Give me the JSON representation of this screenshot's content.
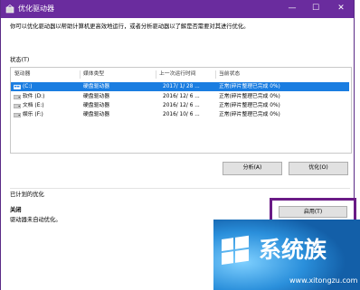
{
  "window": {
    "title": "优化驱动器",
    "minimize": "—",
    "maximize": "☐",
    "close": "✕"
  },
  "description": "你可以优化驱动器以帮助计算机更高效地运行，或者分析驱动器以了解是否需要对其进行优化。",
  "status_label": "状态(T)",
  "columns": [
    "驱动器",
    "媒体类型",
    "上一次运行时间",
    "当前状态"
  ],
  "drives": [
    {
      "name": "(C:)",
      "media": "硬盘驱动器",
      "last_run": "2017/  1/  28 ...",
      "status": "正常(碎片整理已完成 0%)",
      "selected": true
    },
    {
      "name": "软件 (D:)",
      "media": "硬盘驱动器",
      "last_run": "2016/  12/  6 ...",
      "status": "正常(碎片整理已完成 0%)",
      "selected": false
    },
    {
      "name": "文档 (E:)",
      "media": "硬盘驱动器",
      "last_run": "2016/  12/  6 ...",
      "status": "正常(碎片整理已完成 0%)",
      "selected": false
    },
    {
      "name": "娱乐 (F:)",
      "media": "硬盘驱动器",
      "last_run": "2016/  10/  6 ...",
      "status": "正常(碎片整理已完成 0%)",
      "selected": false
    }
  ],
  "buttons": {
    "analyze": "分析(A)",
    "optimize": "优化(O)",
    "enable": "启用(T)"
  },
  "scheduled": {
    "label": "已计划的优化",
    "state": "关闭",
    "detail": "驱动器未自动优化。"
  },
  "watermark": {
    "brand": "系统族",
    "url": "xitongzu.com",
    "url_display": "www.xitongzu.com"
  },
  "colors": {
    "titlebar": "#6a2c9e",
    "selection": "#1a7de1",
    "highlight_box": "#6a1b86",
    "watermark_bg": "#1a78c6"
  }
}
